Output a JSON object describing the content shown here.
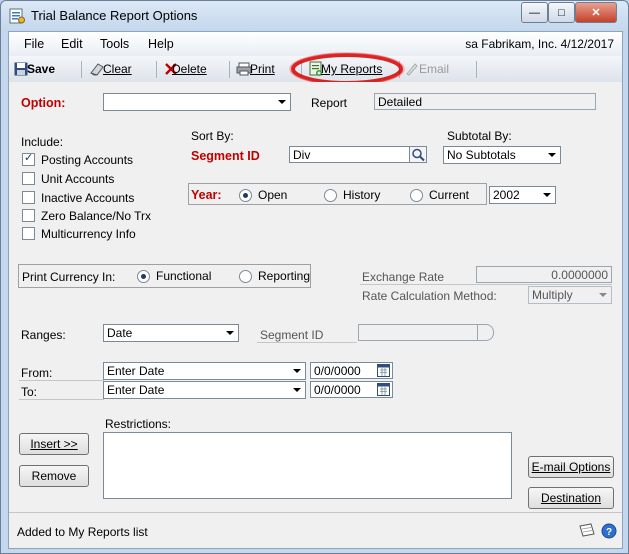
{
  "window": {
    "title": "Trial Balance Report Options",
    "min_glyph": "—",
    "max_glyph": "□",
    "close_glyph": "✕"
  },
  "menu": {
    "items": [
      "File",
      "Edit",
      "Tools",
      "Help"
    ],
    "context": "sa  Fabrikam, Inc.  4/12/2017"
  },
  "toolbar": {
    "save": "Save",
    "clear": "Clear",
    "delete": "Delete",
    "print": "Print",
    "my_reports": "My Reports",
    "email": "Email"
  },
  "option": {
    "label": "Option:",
    "value": "",
    "report_label": "Report",
    "report_value": "Detailed"
  },
  "include": {
    "label": "Include:",
    "items": [
      {
        "label": "Posting Accounts",
        "checked": true
      },
      {
        "label": "Unit Accounts",
        "checked": false
      },
      {
        "label": "Inactive Accounts",
        "checked": false
      },
      {
        "label": "Zero Balance/No Trx",
        "checked": false
      },
      {
        "label": "Multicurrency Info",
        "checked": false
      }
    ]
  },
  "sort": {
    "label": "Sort By:",
    "field_label": "Segment ID",
    "value": "Div"
  },
  "subtotal": {
    "label": "Subtotal By:",
    "value": "No Subtotals"
  },
  "year": {
    "label": "Year:",
    "options": [
      "Open",
      "History",
      "Current"
    ],
    "selected": "Open",
    "value": "2002"
  },
  "currency": {
    "label": "Print Currency In:",
    "options": [
      "Functional",
      "Reporting"
    ],
    "selected": "Functional"
  },
  "exchange": {
    "rate_label": "Exchange Rate",
    "rate_value": "0.0000000",
    "method_label": "Rate Calculation Method:",
    "method_value": "Multiply"
  },
  "ranges": {
    "label": "Ranges:",
    "value": "Date",
    "segment_label": "Segment ID",
    "segment_value": ""
  },
  "from": {
    "label": "From:",
    "value": "Enter Date",
    "date": "0/0/0000"
  },
  "to": {
    "label": "To:",
    "value": "Enter Date",
    "date": "0/0/0000"
  },
  "restrictions": {
    "label": "Restrictions:"
  },
  "buttons": {
    "insert": "Insert >>",
    "remove": "Remove",
    "email_options": "E-mail Options",
    "destination": "Destination"
  },
  "status": {
    "message": "Added to My Reports list"
  },
  "colors": {
    "required_label": "#c00000",
    "highlight_ring": "#d40000"
  }
}
